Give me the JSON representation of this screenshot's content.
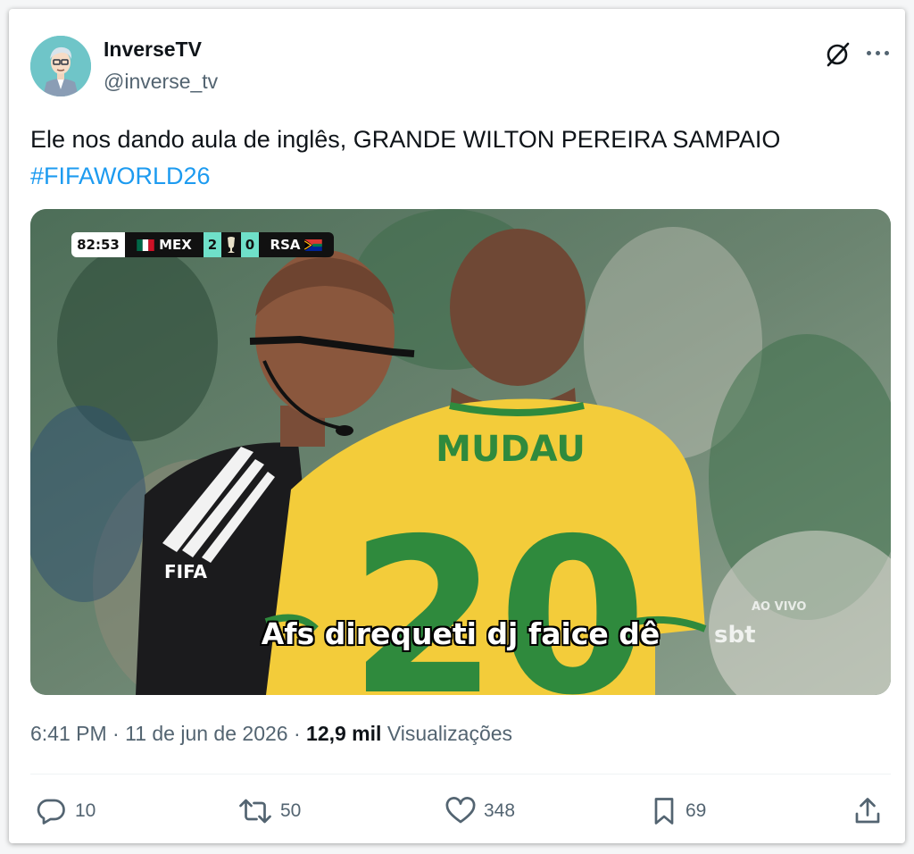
{
  "author": {
    "display_name": "InverseTV",
    "handle": "@inverse_tv"
  },
  "tweet": {
    "text": "Ele nos dando aula de inglês, GRANDE WILTON PEREIRA SAMPAIO",
    "hashtag": "#FIFAWORLD26"
  },
  "media": {
    "scoreboard": {
      "clock": "82:53",
      "home_team": "MEX",
      "home_score": "2",
      "away_score": "0",
      "away_team": "RSA"
    },
    "jersey_name": "MUDAU",
    "jersey_number": "20",
    "sleeve_text": "FIFA",
    "subtitle": "Afs direqueti dj faice dê",
    "broadcast_label": "AO VIVO",
    "broadcaster": "sbt"
  },
  "meta": {
    "time": "6:41 PM",
    "date": "11 de jun de 2026",
    "views_count": "12,9 mil",
    "views_label": "Visualizações"
  },
  "actions": {
    "replies": "10",
    "reposts": "50",
    "likes": "348",
    "bookmarks": "69"
  },
  "colors": {
    "link": "#1d9bf0",
    "secondary_text": "#536471",
    "primary_text": "#0f1419"
  }
}
